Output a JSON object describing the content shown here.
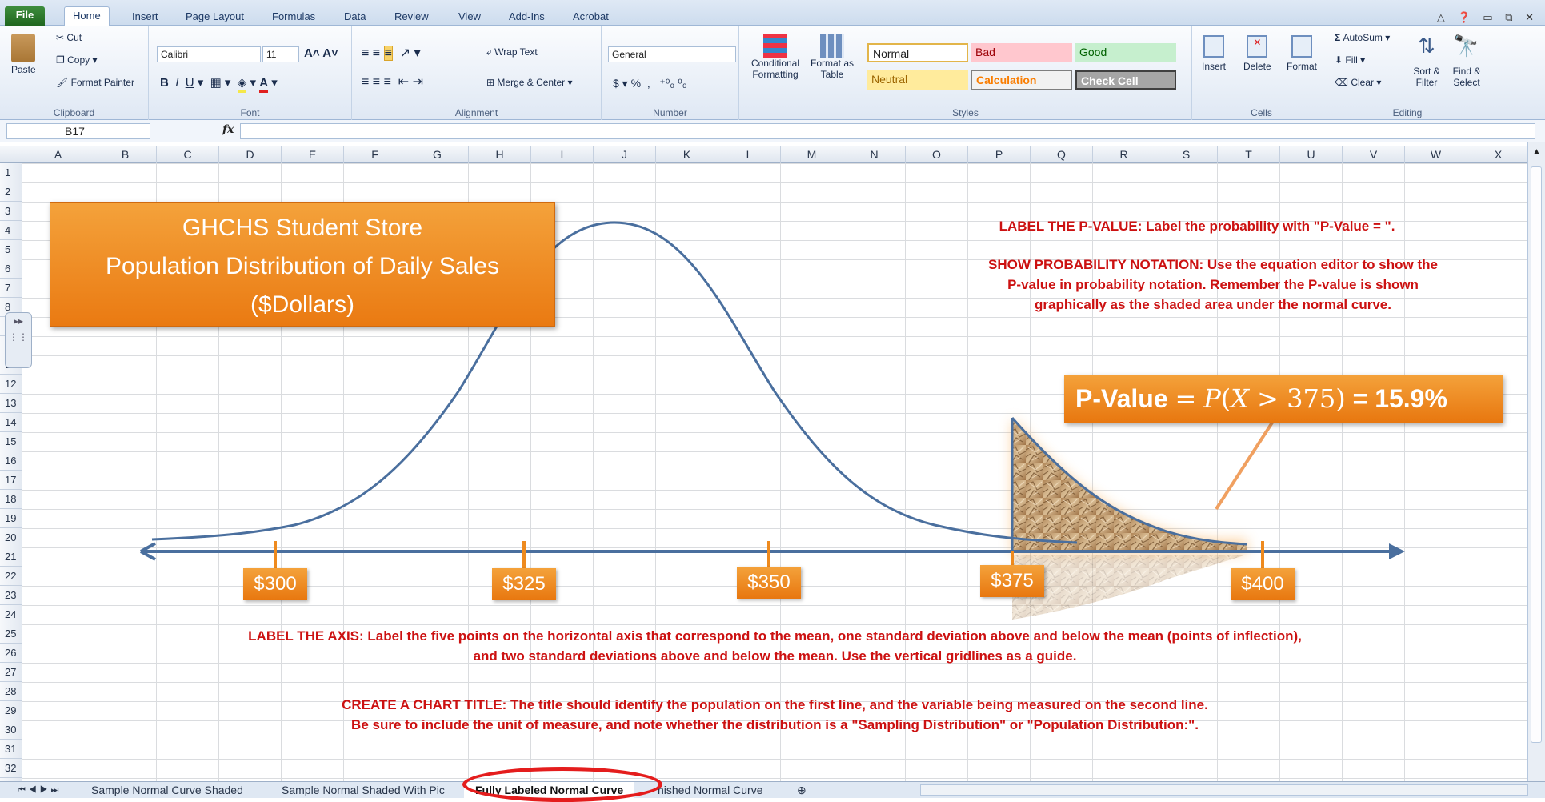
{
  "ribbon": {
    "tabs": [
      "File",
      "Home",
      "Insert",
      "Page Layout",
      "Formulas",
      "Data",
      "Review",
      "View",
      "Add-Ins",
      "Acrobat"
    ],
    "clipboard": {
      "paste": "Paste",
      "cut": "Cut",
      "copy": "Copy",
      "format_painter": "Format Painter",
      "label": "Clipboard"
    },
    "font": {
      "name": "Calibri",
      "size": "11",
      "label": "Font"
    },
    "alignment": {
      "wrap_text": "Wrap Text",
      "merge_center": "Merge & Center",
      "label": "Alignment"
    },
    "number": {
      "format": "General",
      "label": "Number"
    },
    "styles": {
      "conditional": "Conditional Formatting",
      "format_table": "Format as Table",
      "normal": "Normal",
      "bad": "Bad",
      "good": "Good",
      "neutral": "Neutral",
      "calculation": "Calculation",
      "check_cell": "Check Cell",
      "label": "Styles"
    },
    "cells": {
      "insert": "Insert",
      "delete": "Delete",
      "format": "Format",
      "label": "Cells"
    },
    "editing": {
      "autosum": "AutoSum",
      "fill": "Fill",
      "clear": "Clear",
      "sort_filter": "Sort & Filter",
      "find_select": "Find & Select",
      "label": "Editing"
    }
  },
  "formula_bar": {
    "name_box": "B17",
    "fx": "fx",
    "value": ""
  },
  "columns": [
    "A",
    "B",
    "C",
    "D",
    "E",
    "F",
    "G",
    "H",
    "I",
    "J",
    "K",
    "L",
    "M",
    "N",
    "O",
    "P",
    "Q",
    "R",
    "S",
    "T",
    "U",
    "V",
    "W",
    "X"
  ],
  "rows": [
    "1",
    "2",
    "3",
    "4",
    "5",
    "6",
    "7",
    "8",
    "9",
    "10",
    "11",
    "12",
    "13",
    "14",
    "15",
    "16",
    "17",
    "18",
    "19",
    "20",
    "21",
    "22",
    "23",
    "24",
    "25",
    "26",
    "27",
    "28",
    "29",
    "30",
    "31",
    "32"
  ],
  "title_box": {
    "line1": "GHCHS Student Store",
    "line2": "Population Distribution of Daily Sales",
    "line3": "($Dollars)"
  },
  "instructions": {
    "pvalue_label": "LABEL THE P-VALUE:  Label the probability with \"P-Value =   \".",
    "notation_1": "SHOW PROBABILITY NOTATION: Use the equation editor to show the",
    "notation_2": "P-value in probability notation.  Remember the P-value is shown",
    "notation_3": "graphically as the shaded area under the normal curve.",
    "axis_1": "LABEL THE AXIS: Label the five points on the horizontal axis that correspond to the mean, one standard deviation above and below the mean (points of inflection),",
    "axis_2": "and two standard deviations above and below the mean.  Use the vertical gridlines as a guide.",
    "title_1": "CREATE A CHART TITLE: The title should identify the population on the first line, and the variable being measured on the second line.",
    "title_2": "Be sure to include the unit of measure, and note whether the distribution is a \"Sampling Distribution\" or \"Population Distribution:\"."
  },
  "pvalue_box": {
    "prefix": "P-Value",
    "equals": "=",
    "expr_p": "P",
    "expr_open": "(",
    "expr_x": "X",
    "expr_op": ">",
    "expr_val": "375",
    "expr_close": ")",
    "result": "= 15.9%"
  },
  "axis_labels": [
    "$300",
    "$325",
    "$350",
    "$375",
    "$400"
  ],
  "sheet_tabs": [
    "Sample Normal Curve Shaded",
    "Sample Normal Shaded With Pic",
    "Fully Labeled Normal Curve",
    "nished Normal Curve"
  ],
  "colors": {
    "accent_orange": "#ee8a1e",
    "instruction_red": "#cc1111",
    "curve_blue": "#4a6f9e",
    "annotation_circle": "#e41d1d"
  }
}
